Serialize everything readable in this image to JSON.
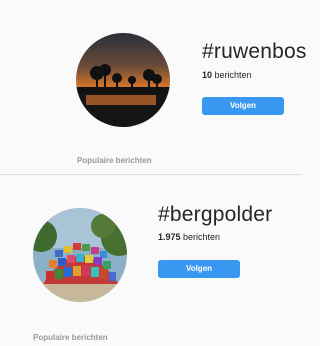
{
  "tags": [
    {
      "hashtag": "#ruwenbos",
      "count": "10",
      "count_suffix": " berichten",
      "follow_label": "Volgen",
      "section_label": "Populaire berichten",
      "image": "sunset-forest-photo"
    },
    {
      "hashtag": "#bergpolder",
      "count": "1.975",
      "count_suffix": " berichten",
      "follow_label": "Volgen",
      "section_label": "Populaire berichten",
      "image": "colorful-dome-photo"
    }
  ],
  "colors": {
    "background": "#fafafa",
    "button": "#3897f0",
    "divider": "#dbdbdb",
    "muted_text": "#999999"
  }
}
